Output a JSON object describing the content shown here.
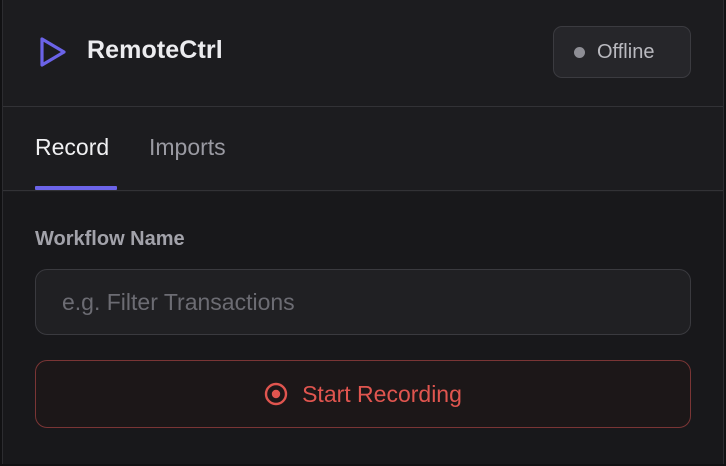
{
  "header": {
    "app_title": "RemoteCtrl",
    "logo_icon": "play-triangle-icon",
    "status": {
      "label": "Offline",
      "dot_color": "#8e8e95"
    }
  },
  "tabs": [
    {
      "label": "Record",
      "active": true
    },
    {
      "label": "Imports",
      "active": false
    }
  ],
  "form": {
    "workflow_name": {
      "label": "Workflow Name",
      "value": "",
      "placeholder": "e.g. Filter Transactions"
    },
    "record_button": {
      "label": "Start Recording",
      "icon": "record-circle-icon"
    }
  },
  "colors": {
    "accent": "#6b63e8",
    "danger": "#e0554f",
    "background": "#1c1c1f"
  }
}
